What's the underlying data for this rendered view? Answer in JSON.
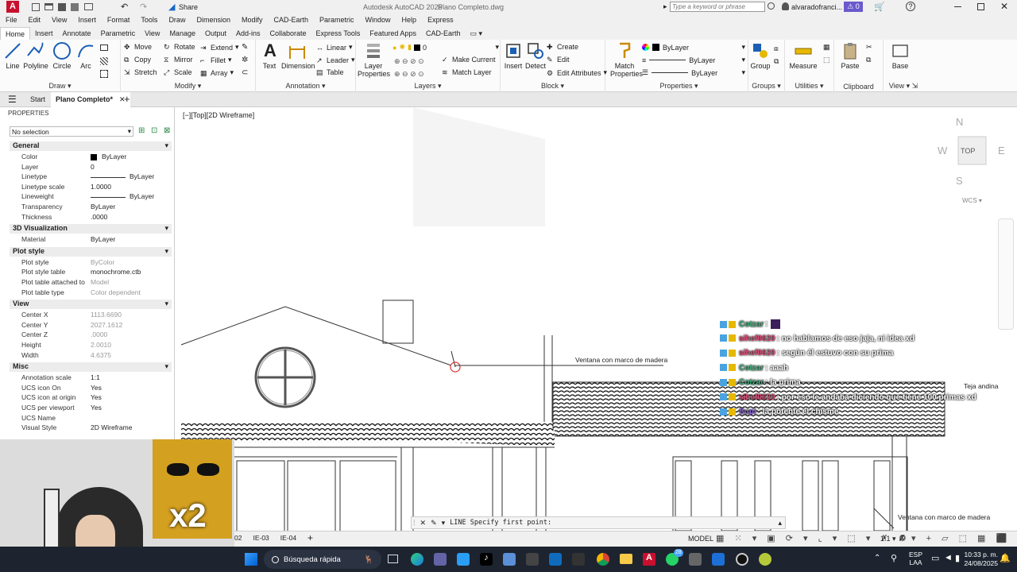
{
  "titlebar": {
    "app_letter": "A",
    "share_label": "Share",
    "title": "Autodesk AutoCAD 2025",
    "document": "Plano Completo.dwg",
    "search_placeholder": "Type a keyword or phrase",
    "user": "alvaradofranci...",
    "notifications": "0"
  },
  "menubar": [
    "File",
    "Edit",
    "View",
    "Insert",
    "Format",
    "Tools",
    "Draw",
    "Dimension",
    "Modify",
    "CAD-Earth",
    "Parametric",
    "Window",
    "Help",
    "Express"
  ],
  "ribbon_tabs": [
    "Home",
    "Insert",
    "Annotate",
    "Parametric",
    "View",
    "Manage",
    "Output",
    "Add-ins",
    "Collaborate",
    "Express Tools",
    "Featured Apps",
    "CAD-Earth"
  ],
  "ribbon": {
    "draw": {
      "label": "Draw",
      "line": "Line",
      "polyline": "Polyline",
      "circle": "Circle",
      "arc": "Arc"
    },
    "modify": {
      "label": "Modify",
      "move": "Move",
      "rotate": "Rotate",
      "extend": "Extend",
      "copy": "Copy",
      "mirror": "Mirror",
      "fillet": "Fillet",
      "stretch": "Stretch",
      "scale": "Scale",
      "array": "Array"
    },
    "annotation": {
      "label": "Annotation",
      "text": "Text",
      "dimension": "Dimension",
      "linear": "Linear",
      "leader": "Leader",
      "table": "Table"
    },
    "layers": {
      "label": "Layers",
      "layer_properties": "Layer Properties",
      "layer_value": "0",
      "make_current": "Make Current",
      "match_layer": "Match Layer"
    },
    "block": {
      "label": "Block",
      "insert": "Insert",
      "detect": "Detect",
      "create": "Create",
      "edit": "Edit",
      "edit_attributes": "Edit Attributes"
    },
    "properties": {
      "label": "Properties",
      "match": "Match Properties",
      "color": "ByLayer",
      "linetype": "ByLayer",
      "lineweight": "ByLayer"
    },
    "groups": {
      "label": "Groups",
      "group": "Group"
    },
    "utilities": {
      "label": "Utilities",
      "measure": "Measure"
    },
    "clipboard": {
      "label": "Clipboard",
      "paste": "Paste"
    },
    "view": {
      "label": "View",
      "base": "Base"
    }
  },
  "doctabs": {
    "start": "Start",
    "active": "Plano Completo*"
  },
  "properties": {
    "title": "PROPERTIES",
    "selection": "No selection",
    "sections": {
      "general": "General",
      "viz3d": "3D Visualization",
      "plot": "Plot style",
      "view": "View",
      "misc": "Misc"
    },
    "general": [
      {
        "k": "Color",
        "v": "ByLayer"
      },
      {
        "k": "Layer",
        "v": "0"
      },
      {
        "k": "Linetype",
        "v": "ByLayer"
      },
      {
        "k": "Linetype scale",
        "v": "1.0000"
      },
      {
        "k": "Lineweight",
        "v": "ByLayer"
      },
      {
        "k": "Transparency",
        "v": "ByLayer"
      },
      {
        "k": "Thickness",
        "v": ".0000"
      }
    ],
    "viz3d": [
      {
        "k": "Material",
        "v": "ByLayer"
      }
    ],
    "plot": [
      {
        "k": "Plot style",
        "v": "ByColor"
      },
      {
        "k": "Plot style table",
        "v": "monochrome.ctb"
      },
      {
        "k": "Plot table attached to",
        "v": "Model"
      },
      {
        "k": "Plot table type",
        "v": "Color dependent"
      }
    ],
    "view": [
      {
        "k": "Center X",
        "v": "1113.6690"
      },
      {
        "k": "Center Y",
        "v": "2027.1612"
      },
      {
        "k": "Center Z",
        "v": ".0000"
      },
      {
        "k": "Height",
        "v": "2.0010"
      },
      {
        "k": "Width",
        "v": "4.6375"
      }
    ],
    "misc": [
      {
        "k": "Annotation scale",
        "v": "1:1"
      },
      {
        "k": "UCS icon On",
        "v": "Yes"
      },
      {
        "k": "UCS icon at origin",
        "v": "Yes"
      },
      {
        "k": "UCS per viewport",
        "v": "Yes"
      },
      {
        "k": "UCS Name",
        "v": ""
      },
      {
        "k": "Visual Style",
        "v": "2D Wireframe"
      }
    ]
  },
  "viewport_label": "[−][Top][2D Wireframe]",
  "viewcube": {
    "n": "N",
    "s": "S",
    "e": "E",
    "w": "W",
    "top": "TOP",
    "wcs": "WCS"
  },
  "drawing_labels": {
    "window1": "Ventana con marco de madera",
    "roof": "Teja andina",
    "window2": "Ventana con marco de madera"
  },
  "chat": [
    {
      "name": "Cotzar",
      "msg": ":",
      "cls": "#3fb07a"
    },
    {
      "name": "sihef0620",
      "msg": ": no hablamos de eso jaja, ni idea xd",
      "cls": "#e24d7a"
    },
    {
      "name": "sihef0620",
      "msg": ": según él estuvo con su prima",
      "cls": "#e24d7a"
    },
    {
      "name": "Cotzar",
      "msg": ": aaah",
      "cls": "#3fb07a"
    },
    {
      "name": "Cotzar",
      "msg": ": la prima",
      "cls": "#3fb07a"
    },
    {
      "name": "sihef0620",
      "msg": ": por eso le andaba diciendo que tiene 100 primas xd",
      "cls": "#e24d7a"
    },
    {
      "name": "Supi",
      "msg": ": la potente el chisme",
      "cls": "#8a64d6"
    }
  ],
  "command": {
    "text": "LINE Specify first point:"
  },
  "layout_tabs": [
    "02",
    "IE-03",
    "IE-04"
  ],
  "status": {
    "model": "MODEL",
    "scale": "1:1"
  },
  "webcam": {
    "badge": "x2"
  },
  "taskbar": {
    "search": "Búsqueda rápida",
    "lang1": "ESP",
    "lang2": "LAA",
    "time": "10:33 p. m.",
    "date": "24/08/2025",
    "badge": "28"
  }
}
